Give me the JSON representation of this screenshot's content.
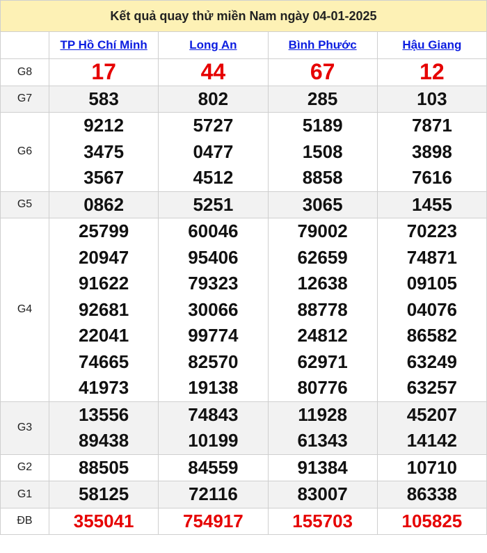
{
  "title": "Kết quả quay thử miền Nam ngày 04-01-2025",
  "provinces": [
    "TP Hồ Chí Minh",
    "Long An",
    "Bình Phước",
    "Hậu Giang"
  ],
  "prizes": [
    {
      "label": "G8",
      "values": [
        [
          "17"
        ],
        [
          "44"
        ],
        [
          "67"
        ],
        [
          "12"
        ]
      ]
    },
    {
      "label": "G7",
      "values": [
        [
          "583"
        ],
        [
          "802"
        ],
        [
          "285"
        ],
        [
          "103"
        ]
      ]
    },
    {
      "label": "G6",
      "values": [
        [
          "9212",
          "3475",
          "3567"
        ],
        [
          "5727",
          "0477",
          "4512"
        ],
        [
          "5189",
          "1508",
          "8858"
        ],
        [
          "7871",
          "3898",
          "7616"
        ]
      ]
    },
    {
      "label": "G5",
      "values": [
        [
          "0862"
        ],
        [
          "5251"
        ],
        [
          "3065"
        ],
        [
          "1455"
        ]
      ]
    },
    {
      "label": "G4",
      "values": [
        [
          "25799",
          "20947",
          "91622",
          "92681",
          "22041",
          "74665",
          "41973"
        ],
        [
          "60046",
          "95406",
          "79323",
          "30066",
          "99774",
          "82570",
          "19138"
        ],
        [
          "79002",
          "62659",
          "12638",
          "88778",
          "24812",
          "62971",
          "80776"
        ],
        [
          "70223",
          "74871",
          "09105",
          "04076",
          "86582",
          "63249",
          "63257"
        ]
      ]
    },
    {
      "label": "G3",
      "values": [
        [
          "13556",
          "89438"
        ],
        [
          "74843",
          "10199"
        ],
        [
          "11928",
          "61343"
        ],
        [
          "45207",
          "14142"
        ]
      ]
    },
    {
      "label": "G2",
      "values": [
        [
          "88505"
        ],
        [
          "84559"
        ],
        [
          "91384"
        ],
        [
          "10710"
        ]
      ]
    },
    {
      "label": "G1",
      "values": [
        [
          "58125"
        ],
        [
          "72116"
        ],
        [
          "83007"
        ],
        [
          "86338"
        ]
      ]
    },
    {
      "label": "ĐB",
      "values": [
        [
          "355041"
        ],
        [
          "754917"
        ],
        [
          "155703"
        ],
        [
          "105825"
        ]
      ]
    }
  ],
  "colors": {
    "header_bg": "#fdf1b5",
    "province_link": "#0b1de0",
    "highlight_red": "#e60000",
    "alt_row": "#f2f2f2"
  }
}
